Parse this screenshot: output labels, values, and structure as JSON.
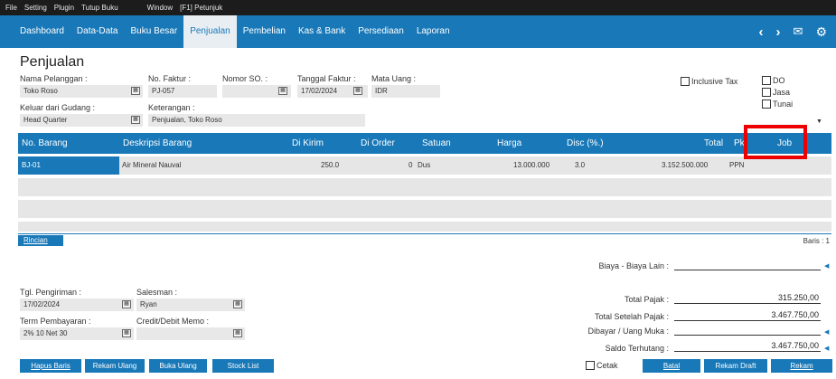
{
  "menubar": {
    "items": [
      "File",
      "Setting",
      "Plugin",
      "Tutup Buku"
    ],
    "window": "Window",
    "help": "[F1] Petunjuk"
  },
  "nav": {
    "items": [
      "Dashboard",
      "Data-Data",
      "Buku Besar",
      "Penjualan",
      "Pembelian",
      "Kas & Bank",
      "Persediaan",
      "Laporan"
    ],
    "active": "Penjualan",
    "icons": [
      "chevron-left-icon",
      "chevron-right-icon",
      "mail-icon",
      "gear-icon"
    ]
  },
  "page_title": "Penjualan",
  "form": {
    "customer_label": "Nama Pelanggan :",
    "customer_value": "Toko Roso",
    "invoice_no_label": "No. Faktur :",
    "invoice_no_value": "PJ-057",
    "so_label": "Nomor SO. :",
    "so_value": "",
    "invoice_date_label": "Tanggal Faktur :",
    "invoice_date_value": "17/02/2024",
    "currency_label": "Mata Uang :",
    "currency_value": "IDR",
    "warehouse_label": "Keluar dari Gudang :",
    "warehouse_value": "Head Quarter",
    "note_label": "Keterangan :",
    "note_value": "Penjualan, Toko Roso",
    "inclusive_tax": "Inclusive Tax",
    "do_label": "DO",
    "jasa_label": "Jasa",
    "tunai_label": "Tunai"
  },
  "grid": {
    "columns": [
      "No. Barang",
      "Deskripsi Barang",
      "Di Kirim",
      "Di Order",
      "Satuan",
      "Harga",
      "Disc (%.)",
      "Total",
      "Pk",
      "Job"
    ],
    "rows": [
      {
        "no": "BJ-01",
        "desc": "Air Mineral Nauval",
        "kirim": "250.0",
        "order": "0",
        "satuan": "Dus",
        "harga": "13.000.000",
        "disc": "3.0",
        "total": "3.152.500.000",
        "pajak": "PPN"
      }
    ]
  },
  "tab": {
    "rincian": "Rincian",
    "baris": "Baris : 1"
  },
  "footer": {
    "ship_date_label": "Tgl. Pengiriman :",
    "ship_date_value": "17/02/2024",
    "salesman_label": "Salesman :",
    "salesman_value": "Ryan",
    "term_label": "Term Pembayaran :",
    "term_value": "2% 10 Net 30",
    "memo_label": "Credit/Debit Memo :",
    "memo_value": ""
  },
  "summary": {
    "biaya_label": "Biaya - Biaya Lain :",
    "biaya_value": "",
    "pajak_label": "Total Pajak :",
    "pajak_value": "315.250,00",
    "setelah_pajak_label": "Total Setelah Pajak :",
    "setelah_pajak_value": "3.467.750,00",
    "dibayar_label": "Dibayar / Uang Muka :",
    "dibayar_value": "",
    "saldo_label": "Saldo Terhutang :",
    "saldo_value": "3.467.750,00"
  },
  "buttons": {
    "hapus": "Hapus Baris",
    "rekam_ulang": "Rekam Ulang",
    "buka_ulang": "Buka Ulang",
    "stock_list": "Stock List",
    "cetak": "Cetak",
    "batal": "Batal",
    "rekam_draft": "Rekam Draft",
    "rekam": "Rekam"
  },
  "colors": {
    "accent": "#1878b8",
    "highlight": "#ee0000",
    "menubar": "#1c1c1c"
  }
}
